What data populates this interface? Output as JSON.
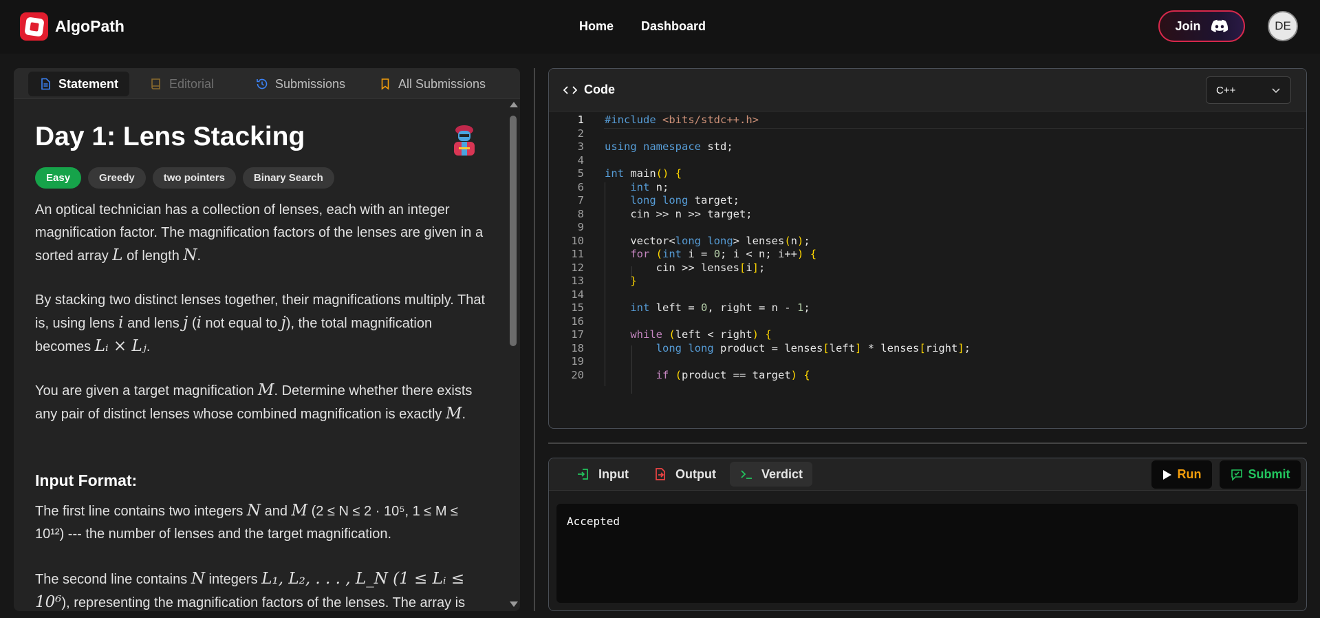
{
  "header": {
    "brand": "AlgoPath",
    "nav": [
      "Home",
      "Dashboard"
    ],
    "join_label": "Join",
    "avatar_initials": "DE"
  },
  "problem_tabs": [
    {
      "label": "Statement",
      "state": "active"
    },
    {
      "label": "Editorial",
      "state": "disabled"
    },
    {
      "label": "Submissions",
      "state": "normal"
    },
    {
      "label": "All Submissions",
      "state": "normal"
    }
  ],
  "problem": {
    "title": "Day 1: Lens Stacking",
    "tags": [
      {
        "label": "Easy",
        "difficulty": true
      },
      {
        "label": "Greedy"
      },
      {
        "label": "two pointers"
      },
      {
        "label": "Binary Search"
      }
    ],
    "p1": {
      "a": "An optical technician has a collection of lenses, each with an integer magnification factor. The magnification factors of the lenses are given in a sorted array ",
      "L": "L",
      "b": " of length ",
      "N": "N",
      "c": "."
    },
    "p2": {
      "a": "By stacking two distinct lenses together, their magnifications multiply. That is, using lens ",
      "i": "i",
      "b": " and lens ",
      "j": "j",
      "c": " (",
      "i2": "i",
      "d": " not equal to ",
      "j2": "j",
      "e": "), the total magnification becomes ",
      "expr": "Lᵢ × Lⱼ",
      "f": "."
    },
    "p3": {
      "a": "You are given a target magnification ",
      "M": "M",
      "b": ". Determine whether there exists any pair of distinct lenses whose combined magnification is exactly ",
      "M2": "M",
      "c": "."
    },
    "input_heading": "Input Format:",
    "p4": {
      "a": "The first line contains two integers ",
      "N": "N",
      "b": " and ",
      "M": "M",
      "c": " (2 ≤ N ≤ 2 · 10⁵, 1 ≤ M ≤ 10¹²) --- the number of lenses and the target magnification."
    },
    "p5": {
      "a": "The second line contains ",
      "N": "N",
      "b": " integers ",
      "expr": "L₁, L₂, . . . , L_N (1 ≤ Lᵢ ≤ 10⁶",
      "c": "), representing the magnification factors of the lenses. The array is"
    }
  },
  "code_panel": {
    "title": "Code",
    "language": "C++",
    "lines": [
      "#include <bits/stdc++.h>",
      "",
      "using namespace std;",
      "",
      "int main() {",
      "    int n;",
      "    long long target;",
      "    cin >> n >> target;",
      "",
      "    vector<long long> lenses(n);",
      "    for (int i = 0; i < n; i++) {",
      "        cin >> lenses[i];",
      "    }",
      "",
      "    int left = 0, right = n - 1;",
      "",
      "    while (left < right) {",
      "        long long product = lenses[left] * lenses[right];",
      "",
      "        if (product == target) {"
    ],
    "active_line": 1
  },
  "io_panel": {
    "tabs": [
      "Input",
      "Output",
      "Verdict"
    ],
    "active_tab": "Verdict",
    "run_label": "Run",
    "submit_label": "Submit",
    "verdict": "Accepted"
  },
  "colors": {
    "brand_red": "#e11d2e",
    "easy_green": "#16a34a",
    "run_orange": "#f59e0b",
    "submit_green": "#22c55e"
  }
}
